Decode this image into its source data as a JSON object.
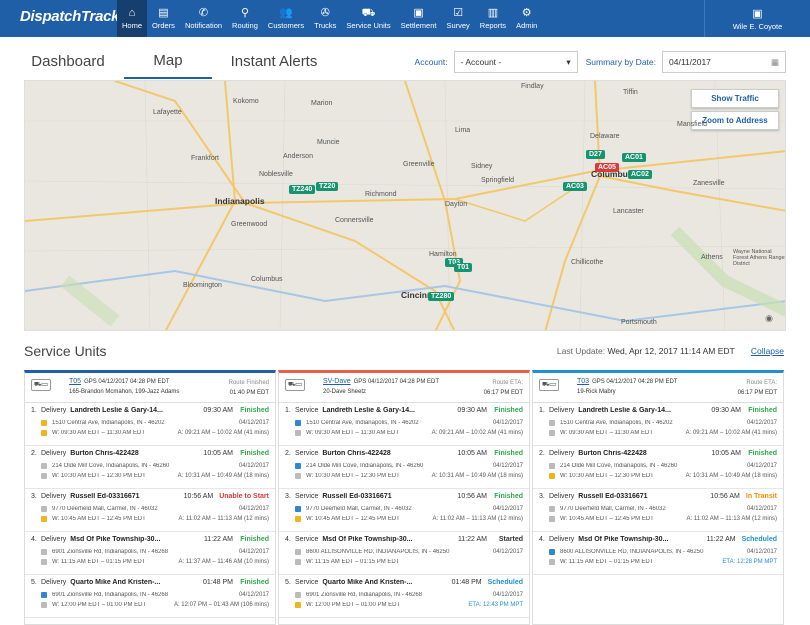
{
  "app": {
    "logo": "DispatchTrack"
  },
  "nav": {
    "items": [
      {
        "label": "Home",
        "icon": "home-icon",
        "glyph": "⌂"
      },
      {
        "label": "Orders",
        "icon": "orders-icon",
        "glyph": "▤"
      },
      {
        "label": "Notification",
        "icon": "phone-icon",
        "glyph": "✆"
      },
      {
        "label": "Routing",
        "icon": "routing-icon",
        "glyph": "⚲"
      },
      {
        "label": "Customers",
        "icon": "customers-icon",
        "glyph": "👥"
      },
      {
        "label": "Trucks",
        "icon": "wrench-icon",
        "glyph": "✇"
      },
      {
        "label": "Service Units",
        "icon": "truck-icon",
        "glyph": "⛟"
      },
      {
        "label": "Settlement",
        "icon": "clipboard-icon",
        "glyph": "▣"
      },
      {
        "label": "Survey",
        "icon": "survey-icon",
        "glyph": "☑"
      },
      {
        "label": "Reports",
        "icon": "reports-icon",
        "glyph": "▥"
      },
      {
        "label": "Admin",
        "icon": "gear-icon",
        "glyph": "⚙"
      }
    ],
    "user": "Wile E. Coyote"
  },
  "tabs": [
    "Dashboard",
    "Map",
    "Instant Alerts"
  ],
  "filters": {
    "account_label": "Account:",
    "account_value": "- Account -",
    "summary_label": "Summary by Date:",
    "date_value": "04/11/2017"
  },
  "map": {
    "show_traffic": "Show Traffic",
    "zoom_address": "Zoom to Address",
    "cities": [
      {
        "name": "Kokomo"
      },
      {
        "name": "Lafayette"
      },
      {
        "name": "Marion"
      },
      {
        "name": "Lima"
      },
      {
        "name": "Findlay"
      },
      {
        "name": "Tiffin"
      },
      {
        "name": "Mansfield"
      },
      {
        "name": "Muncie"
      },
      {
        "name": "Sidney"
      },
      {
        "name": "Delaware"
      },
      {
        "name": "Anderson"
      },
      {
        "name": "Springfield"
      },
      {
        "name": "Columbus"
      },
      {
        "name": "Zanesville"
      },
      {
        "name": "Indianapolis"
      },
      {
        "name": "Richmond"
      },
      {
        "name": "Dayton"
      },
      {
        "name": "Greenwood"
      },
      {
        "name": "Lancaster"
      },
      {
        "name": "Connersville"
      },
      {
        "name": "Hamilton"
      },
      {
        "name": "Chillicothe"
      },
      {
        "name": "Athens"
      },
      {
        "name": "Bloomington"
      },
      {
        "name": "Columbus"
      },
      {
        "name": "Cincinnati"
      },
      {
        "name": "Portsmouth"
      },
      {
        "name": "Noblesville"
      },
      {
        "name": "Greenville"
      },
      {
        "name": "Frankfort"
      },
      {
        "name": "Wayne National Forest Athens Ranger District"
      }
    ],
    "pins": [
      {
        "label": "TZ240"
      },
      {
        "label": "TZ20"
      },
      {
        "label": "D27"
      },
      {
        "label": "AC01"
      },
      {
        "label": "AC05"
      },
      {
        "label": "AC02"
      },
      {
        "label": "AC03"
      },
      {
        "label": "T03"
      },
      {
        "label": "T01"
      },
      {
        "label": "TZ280"
      }
    ]
  },
  "service_units": {
    "title": "Service Units",
    "last_update_label": "Last Update:",
    "last_update_value": "Wed, Apr 12, 2017  11:14 AM EDT",
    "collapse": "Collapse",
    "columns": [
      {
        "color": "#1f5fa8",
        "unit": "T05",
        "gps": "GPS  04/12/2017 04:28 PM EDT",
        "crew": "165-Brandon Mcmahon, 199-Jazz Adams",
        "right_label": "Route Finished",
        "right_value": "01:40 PM EDT",
        "stops": [
          {
            "num": "1.",
            "type": "Delivery",
            "cust": "Landreth Leslie & Gary-14...",
            "time": "09:30 AM",
            "status": "Finished",
            "cls": "st-fin",
            "addr": "1510 Central Ave, Indianapolis, IN - 46202",
            "date": "04/12/2017",
            "sq1": "sq-yel",
            "window": "W: 09:30 AM EDT  –  11:30 AM EDT",
            "actual": "A: 09:21 AM – 10:02 AM (41 mins)",
            "sq2": "sq-yel"
          },
          {
            "num": "2.",
            "type": "Delivery",
            "cust": "Burton Chris-422428",
            "time": "10:05 AM",
            "status": "Finished",
            "cls": "st-fin",
            "addr": "214 Olde Mill Cove, Indianapolis, IN - 46260",
            "date": "04/12/2017",
            "sq1": "sq-gray",
            "window": "W: 10:30 AM EDT  –  12:30 PM EDT",
            "actual": "A: 10:31 AM – 10:49 AM (18 mins)",
            "sq2": "sq-gray"
          },
          {
            "num": "3.",
            "type": "Delivery",
            "cust": "Russell Ed-03316671",
            "time": "10:56 AM",
            "status": "Unable to Start",
            "cls": "st-red",
            "addr": "9770 Deerfield Mall, Carmel, IN - 46032",
            "date": "04/12/2017",
            "sq1": "sq-gray",
            "window": "W: 10:45 AM EDT  –  12:45 PM EDT",
            "actual": "A: 11:02 AM – 11:13 AM (12 mins)",
            "sq2": "sq-yel"
          },
          {
            "num": "4.",
            "type": "Delivery",
            "cust": "Msd Of Pike Township-30...",
            "time": "11:22 AM",
            "status": "Finished",
            "cls": "st-fin",
            "addr": "6901 Zionsville Rd, Indianapolis, IN - 46268",
            "date": "04/12/2017",
            "sq1": "sq-gray",
            "window": "W: 11:15 AM EDT  –  01:15 PM EDT",
            "actual": "A: 11:37 AM – 11:46 AM (10 mins)",
            "sq2": "sq-gray"
          },
          {
            "num": "5.",
            "type": "Delivery",
            "cust": "Quarto Mike And Kristen-...",
            "time": "01:48 PM",
            "status": "Finished",
            "cls": "st-fin",
            "addr": "6901 Zionsville Rd, Indianapolis, IN - 46268",
            "date": "04/12/2017",
            "sq1": "sq-blue",
            "window": "W: 12:00 PM EDT  –  01:00 PM EDT",
            "actual": "A: 12:07 PM – 01:43 AM (106 mins)",
            "sq2": "sq-gray"
          }
        ]
      },
      {
        "color": "#e8604c",
        "unit": "SV-Dave",
        "gps": "GPS  04/12/2017 04:28 PM EDT",
        "crew": "20-Dave Sheetz",
        "right_label": "Route ETA:",
        "right_value": "06:17 PM EDT",
        "stops": [
          {
            "num": "1.",
            "type": "Service",
            "cust": "Landreth Leslie & Gary-14...",
            "time": "09:30 AM",
            "status": "Finished",
            "cls": "st-fin",
            "addr": "1510 Central Ave, Indianapolis, IN - 46202",
            "date": "04/12/2017",
            "sq1": "sq-blue",
            "window": "W: 09:30 AM EDT  –  11:30 AM EDT",
            "actual": "A: 09:21 AM – 10:02 AM (41 mins)",
            "sq2": "sq-gray"
          },
          {
            "num": "2.",
            "type": "Service",
            "cust": "Burton Chris-422428",
            "time": "10:05 AM",
            "status": "Finished",
            "cls": "st-fin",
            "addr": "214 Olde Mill Cove, Indianapolis, IN - 46260",
            "date": "04/12/2017",
            "sq1": "sq-blue",
            "window": "W: 10:30 AM EDT  –  12:30 PM EDT",
            "actual": "A: 10:31 AM – 10:49 AM (18 mins)",
            "sq2": "sq-gray"
          },
          {
            "num": "3.",
            "type": "Service",
            "cust": "Russell Ed-03316671",
            "time": "10:56 AM",
            "status": "Finished",
            "cls": "st-fin",
            "addr": "9770 Deerfield Mall, Carmel, IN - 46032",
            "date": "04/12/2017",
            "sq1": "sq-blue",
            "window": "W: 10:45 AM EDT  –  12:45 PM EDT",
            "actual": "A: 11:02 AM – 11:13 AM (12 mins)",
            "sq2": "sq-yel"
          },
          {
            "num": "4.",
            "type": "Service",
            "cust": "Msd Of Pike Township-30...",
            "time": "11:22 AM",
            "status": "Started",
            "cls": "st-dk",
            "addr": "8600 ALLISONVILLE RD, INDIANAPOLIS, IN - 46250",
            "date": "04/12/2017",
            "sq1": "sq-gray",
            "window": "W: 11:15 AM EDT  –  01:15 PM EDT",
            "actual": "",
            "sq2": "sq-gray"
          },
          {
            "num": "5.",
            "type": "Service",
            "cust": "Quarto Mike And Kristen-...",
            "time": "01:48 PM",
            "status": "Scheduled",
            "cls": "st-bl",
            "addr": "6901 Zionsville Rd, Indianapolis, IN - 46268",
            "date": "04/12/2017",
            "sq1": "sq-gray",
            "window": "W: 12:00 PM EDT  –  01:00 PM EDT",
            "actual": "ETA: 12:43 PM MPT",
            "sq2": "sq-yel"
          }
        ]
      },
      {
        "color": "#1f8fd6",
        "unit": "T03",
        "gps": "GPS  04/12/2017 04:28 PM EDT",
        "crew": "19-Rick Mabry",
        "right_label": "Route ETA:",
        "right_value": "06:17 PM EDT",
        "stops": [
          {
            "num": "1.",
            "type": "Delivery",
            "cust": "Landreth Leslie & Gary-14...",
            "time": "09:30 AM",
            "status": "Finished",
            "cls": "st-fin",
            "addr": "1510 Central Ave, Indianapolis, IN - 46202",
            "date": "04/12/2017",
            "sq1": "sq-gray",
            "window": "W: 09:30 AM EDT  –  11:30 AM EDT",
            "actual": "A: 09:21 AM – 10:02 AM (41 mins)",
            "sq2": "sq-gray"
          },
          {
            "num": "2.",
            "type": "Delivery",
            "cust": "Burton Chris-422428",
            "time": "10:05 AM",
            "status": "Finished",
            "cls": "st-fin",
            "addr": "214 Olde Mill Cove, Indianapolis, IN - 46260",
            "date": "04/12/2017",
            "sq1": "sq-gray",
            "window": "W: 10:30 AM EDT  –  12:30 PM EDT",
            "actual": "A: 10:31 AM – 10:49 AM (18 mins)",
            "sq2": "sq-yel"
          },
          {
            "num": "3.",
            "type": "Delivery",
            "cust": "Russell Ed-03316671",
            "time": "10:56 AM",
            "status": "In Transit",
            "cls": "st-tr",
            "addr": "9770 Deerfield Mall, Carmel, IN - 46032",
            "date": "04/12/2017",
            "sq1": "sq-gray",
            "window": "W: 10:45 AM EDT  –  12:45 PM EDT",
            "actual": "A: 11:02 AM – 11:13 AM (12 mins)",
            "sq2": "sq-gray"
          },
          {
            "num": "4.",
            "type": "Delivery",
            "cust": "Msd Of Pike Township-30...",
            "time": "11:22 AM",
            "status": "Scheduled",
            "cls": "st-bl",
            "addr": "8600 ALLISONVILLE RD, INDIANAPOLIS, IN - 46250",
            "date": "04/12/2017",
            "sq1": "sq-blue",
            "window": "W: 11:15 AM EDT  –  01:15 PM EDT",
            "actual": "ETA: 12:28 PM MPT",
            "sq2": "sq-gray"
          }
        ]
      }
    ]
  }
}
